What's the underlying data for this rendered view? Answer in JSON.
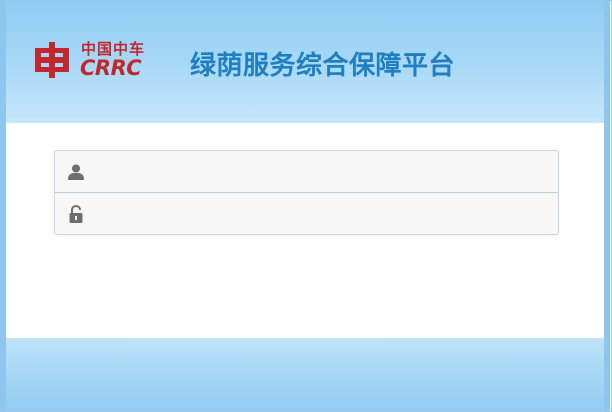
{
  "header": {
    "logo": {
      "name": "crrc-logo",
      "text_cn": "中国中车",
      "text_en": "CRRC",
      "color": "#c2272d"
    },
    "title": "绿荫服务综合保障平台",
    "title_color": "#1f7fc1"
  },
  "login_form": {
    "username": {
      "icon": "user-icon",
      "value": "",
      "placeholder": ""
    },
    "password": {
      "icon": "lock-icon",
      "value": "",
      "placeholder": ""
    }
  },
  "colors": {
    "header_gradient_top": "#8fccf3",
    "header_gradient_bottom": "#c6e6fa",
    "frame_border": "#8ec6ef"
  }
}
